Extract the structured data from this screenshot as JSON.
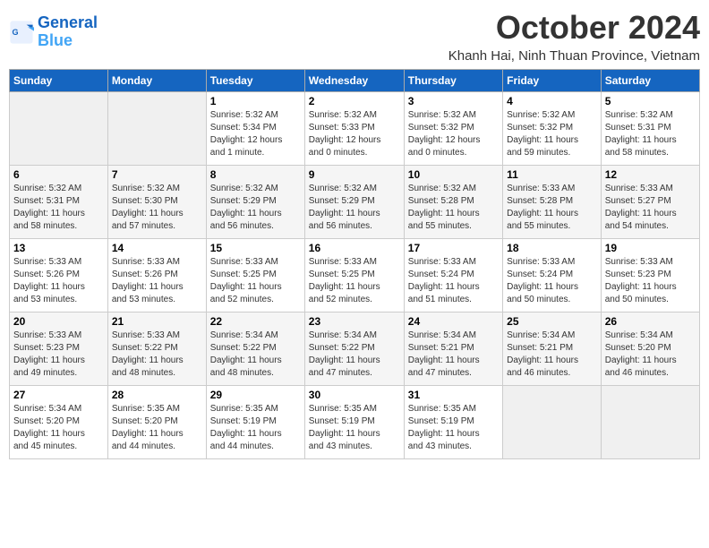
{
  "logo": {
    "line1": "General",
    "line2": "Blue"
  },
  "title": "October 2024",
  "location": "Khanh Hai, Ninh Thuan Province, Vietnam",
  "days_of_week": [
    "Sunday",
    "Monday",
    "Tuesday",
    "Wednesday",
    "Thursday",
    "Friday",
    "Saturday"
  ],
  "weeks": [
    [
      {
        "day": "",
        "info": ""
      },
      {
        "day": "",
        "info": ""
      },
      {
        "day": "1",
        "info": "Sunrise: 5:32 AM\nSunset: 5:34 PM\nDaylight: 12 hours\nand 1 minute."
      },
      {
        "day": "2",
        "info": "Sunrise: 5:32 AM\nSunset: 5:33 PM\nDaylight: 12 hours\nand 0 minutes."
      },
      {
        "day": "3",
        "info": "Sunrise: 5:32 AM\nSunset: 5:32 PM\nDaylight: 12 hours\nand 0 minutes."
      },
      {
        "day": "4",
        "info": "Sunrise: 5:32 AM\nSunset: 5:32 PM\nDaylight: 11 hours\nand 59 minutes."
      },
      {
        "day": "5",
        "info": "Sunrise: 5:32 AM\nSunset: 5:31 PM\nDaylight: 11 hours\nand 58 minutes."
      }
    ],
    [
      {
        "day": "6",
        "info": "Sunrise: 5:32 AM\nSunset: 5:31 PM\nDaylight: 11 hours\nand 58 minutes."
      },
      {
        "day": "7",
        "info": "Sunrise: 5:32 AM\nSunset: 5:30 PM\nDaylight: 11 hours\nand 57 minutes."
      },
      {
        "day": "8",
        "info": "Sunrise: 5:32 AM\nSunset: 5:29 PM\nDaylight: 11 hours\nand 56 minutes."
      },
      {
        "day": "9",
        "info": "Sunrise: 5:32 AM\nSunset: 5:29 PM\nDaylight: 11 hours\nand 56 minutes."
      },
      {
        "day": "10",
        "info": "Sunrise: 5:32 AM\nSunset: 5:28 PM\nDaylight: 11 hours\nand 55 minutes."
      },
      {
        "day": "11",
        "info": "Sunrise: 5:33 AM\nSunset: 5:28 PM\nDaylight: 11 hours\nand 55 minutes."
      },
      {
        "day": "12",
        "info": "Sunrise: 5:33 AM\nSunset: 5:27 PM\nDaylight: 11 hours\nand 54 minutes."
      }
    ],
    [
      {
        "day": "13",
        "info": "Sunrise: 5:33 AM\nSunset: 5:26 PM\nDaylight: 11 hours\nand 53 minutes."
      },
      {
        "day": "14",
        "info": "Sunrise: 5:33 AM\nSunset: 5:26 PM\nDaylight: 11 hours\nand 53 minutes."
      },
      {
        "day": "15",
        "info": "Sunrise: 5:33 AM\nSunset: 5:25 PM\nDaylight: 11 hours\nand 52 minutes."
      },
      {
        "day": "16",
        "info": "Sunrise: 5:33 AM\nSunset: 5:25 PM\nDaylight: 11 hours\nand 52 minutes."
      },
      {
        "day": "17",
        "info": "Sunrise: 5:33 AM\nSunset: 5:24 PM\nDaylight: 11 hours\nand 51 minutes."
      },
      {
        "day": "18",
        "info": "Sunrise: 5:33 AM\nSunset: 5:24 PM\nDaylight: 11 hours\nand 50 minutes."
      },
      {
        "day": "19",
        "info": "Sunrise: 5:33 AM\nSunset: 5:23 PM\nDaylight: 11 hours\nand 50 minutes."
      }
    ],
    [
      {
        "day": "20",
        "info": "Sunrise: 5:33 AM\nSunset: 5:23 PM\nDaylight: 11 hours\nand 49 minutes."
      },
      {
        "day": "21",
        "info": "Sunrise: 5:33 AM\nSunset: 5:22 PM\nDaylight: 11 hours\nand 48 minutes."
      },
      {
        "day": "22",
        "info": "Sunrise: 5:34 AM\nSunset: 5:22 PM\nDaylight: 11 hours\nand 48 minutes."
      },
      {
        "day": "23",
        "info": "Sunrise: 5:34 AM\nSunset: 5:22 PM\nDaylight: 11 hours\nand 47 minutes."
      },
      {
        "day": "24",
        "info": "Sunrise: 5:34 AM\nSunset: 5:21 PM\nDaylight: 11 hours\nand 47 minutes."
      },
      {
        "day": "25",
        "info": "Sunrise: 5:34 AM\nSunset: 5:21 PM\nDaylight: 11 hours\nand 46 minutes."
      },
      {
        "day": "26",
        "info": "Sunrise: 5:34 AM\nSunset: 5:20 PM\nDaylight: 11 hours\nand 46 minutes."
      }
    ],
    [
      {
        "day": "27",
        "info": "Sunrise: 5:34 AM\nSunset: 5:20 PM\nDaylight: 11 hours\nand 45 minutes."
      },
      {
        "day": "28",
        "info": "Sunrise: 5:35 AM\nSunset: 5:20 PM\nDaylight: 11 hours\nand 44 minutes."
      },
      {
        "day": "29",
        "info": "Sunrise: 5:35 AM\nSunset: 5:19 PM\nDaylight: 11 hours\nand 44 minutes."
      },
      {
        "day": "30",
        "info": "Sunrise: 5:35 AM\nSunset: 5:19 PM\nDaylight: 11 hours\nand 43 minutes."
      },
      {
        "day": "31",
        "info": "Sunrise: 5:35 AM\nSunset: 5:19 PM\nDaylight: 11 hours\nand 43 minutes."
      },
      {
        "day": "",
        "info": ""
      },
      {
        "day": "",
        "info": ""
      }
    ]
  ]
}
